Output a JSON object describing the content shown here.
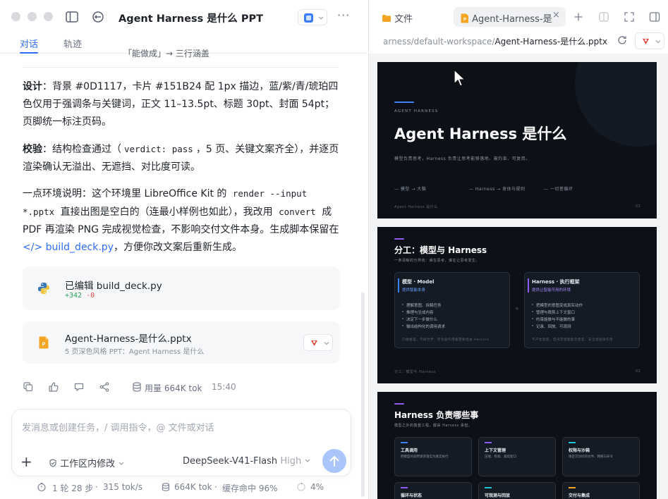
{
  "window": {
    "title": "Agent Harness 是什么 PPT",
    "more": "···"
  },
  "tabs": [
    {
      "label": "对话",
      "active": true
    },
    {
      "label": "轨迹",
      "active": false
    }
  ],
  "conversation": {
    "cut_line": "「能做成」→ 三行涵盖",
    "design_label": "设计",
    "design_text": "：背景 #0D1117，卡片 #151B24 配 1px 描边，蓝/紫/青/琥珀四色仅用于强调条与关键词，正文 11–13.5pt、标题 30pt、封面 54pt；页脚统一标注页码。",
    "check_label": "校验",
    "check_pre": "：结构检查通过（",
    "check_code": "verdict: pass",
    "check_post": "，5 页、关键文案齐全），并逐页渲染确认无溢出、无遮挡、对比度可读。",
    "env_pre": "一点环境说明：这个环境里 LibreOffice Kit 的 ",
    "env_code1": "render --input *.pptx",
    "env_mid1": " 直接出图是空白的（连最小样例也如此），我改用 ",
    "env_code2": "convert",
    "env_mid2": " 成 PDF 再渲染 PNG 完成视觉检查，不影响交付文件本身。生成脚本保留在 ",
    "env_link": "</> build_deck.py",
    "env_post": "，方便你改文案后重新生成。"
  },
  "edit_card": {
    "title": "已编辑 build_deck.py",
    "added": "+342",
    "removed": "-0"
  },
  "file_card": {
    "title": "Agent-Harness-是什么.pptx",
    "subtitle": "5 页深色风格 PPT：Agent Harness 是什么"
  },
  "actions": {
    "usage": "用量 664K tok",
    "time": "15:40"
  },
  "composer": {
    "placeholder": "发消息或创建任务，/ 调用指令，@ 文件或对话",
    "workspace": "工作区内修改",
    "model": "DeepSeek-V41-Flash",
    "level": "High"
  },
  "footer": {
    "turns": "1 轮 28 步",
    "speed": "315 tok/s",
    "tokens": "664K tok",
    "cache": "缓存命中 96%",
    "context": "4%"
  },
  "right": {
    "tab_files": "文件",
    "tab_file": "Agent-Harness-是",
    "path_prefix": "arness/default-workspace/",
    "path_file": "Agent-Harness-是什么.pptx"
  },
  "slides": {
    "s1_kicker": "AGENT HARNESS",
    "s1_title": "Agent Harness  是什么",
    "s1_sub": "模型负责思考，Harness 负责让思考能够落地、被约束、可复用。",
    "s1_k1": "— 模型 → 大脑",
    "s1_k2": "— Harness → 身体与规则",
    "s1_k3": "— 一切皆循环",
    "s1_footer": "Agent Harness 是什么",
    "s1_page": "01",
    "s2_title": "分工：模型与   Harness",
    "s2_sub": "一条清晰的分界线：谁在思考，谁在让思考发生。",
    "s2_c1_title": "模型 · Model",
    "s2_c1_sub": "提供智能本身",
    "s2_c1_items": [
      "理解意图、拆解任务",
      "推理与生成内容",
      "决定下一步做什么",
      "输出结构化的调用请求"
    ],
    "s2_c1_note": "只做推理，不碰世界：所有副作用都需要经由 Harness",
    "s2_c2_title": "Harness · 执行框架",
    "s2_c2_sub": "提供让智能可用的环境",
    "s2_c2_items": [
      "把模型的意图变成真实动作",
      "管理与裁剪上下文窗口",
      "约束能做与不能做的事",
      "记录、回放、可观测"
    ],
    "s2_c2_note": "不产生智能，但决定智能能否稳定、安全地发挥作用",
    "s2_footer": "分工：模型与 Harness",
    "s2_page": "02",
    "s3_title": "Harness  负责哪些事",
    "s3_sub": "模型之外的整套工程，都由 Harness 承担。",
    "s3_c1": "工具调用",
    "s3_c1_sub": "把模型的调用请求落实为真实执行",
    "s3_c2": "上下文管理",
    "s3_c2_sub": "压缩、检索、裁剪窗口",
    "s3_c3": "权限与沙箱",
    "s3_c3_sub": "限定可访问的文件、网络与命令",
    "s3_c4": "循环与状态",
    "s3_c5": "可观测与回放",
    "s3_c6": "交付与集成"
  },
  "colors": {
    "accent_blue": "#2f6df6",
    "slide_bg": "#0d1117",
    "card_bg": "#151b24",
    "blue": "#3b82f6",
    "purple": "#8b5cf6",
    "cyan": "#22c3d6",
    "amber": "#f5a524"
  }
}
